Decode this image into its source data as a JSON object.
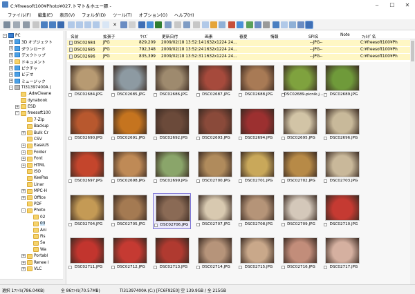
{
  "window": {
    "title": "C:¥freesoft100¥Photo¥027.トマト＆ホエー豚 -",
    "buttons": [
      "minimize",
      "maximize",
      "close"
    ]
  },
  "menu": [
    "ファイル(F)",
    "編集(E)",
    "表示(V)",
    "フォルダ(D)",
    "ツール(T)",
    "オプション(O)",
    "ヘルプ(H)"
  ],
  "tree": [
    {
      "label": "PC",
      "icon": "pc-icon",
      "depth": 0,
      "expander": "-"
    },
    {
      "label": "3D オブジェクト",
      "icon": "folder-blue-icon",
      "depth": 1,
      "expander": "+"
    },
    {
      "label": "ダウンロード",
      "icon": "download-icon",
      "depth": 1,
      "expander": "+"
    },
    {
      "label": "デスクトップ",
      "icon": "desktop-icon",
      "depth": 1,
      "expander": "+"
    },
    {
      "label": "ドキュメント",
      "icon": "documents-icon",
      "depth": 1,
      "expander": "+"
    },
    {
      "label": "ピクチャ",
      "icon": "pictures-icon",
      "depth": 1,
      "expander": "+"
    },
    {
      "label": "ビデオ",
      "icon": "videos-icon",
      "depth": 1,
      "expander": "+"
    },
    {
      "label": "ミュージック",
      "icon": "music-icon",
      "depth": 1,
      "expander": "+"
    },
    {
      "label": "TI31397400A (",
      "icon": "drive-icon",
      "depth": 1,
      "expander": "-"
    },
    {
      "label": ".AdwCleane",
      "icon": "folder-icon",
      "depth": 2,
      "expander": ""
    },
    {
      "label": "dynabook",
      "icon": "folder-icon",
      "depth": 2,
      "expander": ""
    },
    {
      "label": "ESD",
      "icon": "folder-icon",
      "depth": 2,
      "expander": "+"
    },
    {
      "label": "freesoft100",
      "icon": "folder-icon",
      "depth": 2,
      "expander": "-"
    },
    {
      "label": "7-Zip",
      "icon": "folder-icon",
      "depth": 3,
      "expander": ""
    },
    {
      "label": "Backup",
      "icon": "folder-icon",
      "depth": 3,
      "expander": ""
    },
    {
      "label": "Bulk Cr",
      "icon": "folder-icon",
      "depth": 3,
      "expander": "+"
    },
    {
      "label": "CSV",
      "icon": "folder-icon",
      "depth": 3,
      "expander": ""
    },
    {
      "label": "EaseUS",
      "icon": "folder-icon",
      "depth": 3,
      "expander": "+"
    },
    {
      "label": "Folder",
      "icon": "folder-icon",
      "depth": 3,
      "expander": "+"
    },
    {
      "label": "Font",
      "icon": "folder-icon",
      "depth": 3,
      "expander": "+"
    },
    {
      "label": "HTML",
      "icon": "folder-icon",
      "depth": 3,
      "expander": "+"
    },
    {
      "label": "ISO",
      "icon": "folder-icon",
      "depth": 3,
      "expander": ""
    },
    {
      "label": "KeePas",
      "icon": "folder-icon",
      "depth": 3,
      "expander": ""
    },
    {
      "label": "Linar",
      "icon": "folder-icon",
      "depth": 3,
      "expander": ""
    },
    {
      "label": "MPC-H",
      "icon": "folder-icon",
      "depth": 3,
      "expander": "+"
    },
    {
      "label": "Office",
      "icon": "folder-icon",
      "depth": 3,
      "expander": "+"
    },
    {
      "label": "PDF",
      "icon": "folder-icon",
      "depth": 3,
      "expander": ""
    },
    {
      "label": "Photo",
      "icon": "folder-icon",
      "depth": 3,
      "expander": "-"
    },
    {
      "label": "02",
      "icon": "folder-icon",
      "depth": 4,
      "expander": ""
    },
    {
      "label": "03",
      "icon": "folder-icon",
      "depth": 4,
      "expander": "",
      "selected": true
    },
    {
      "label": "Ani",
      "icon": "folder-icon",
      "depth": 4,
      "expander": ""
    },
    {
      "label": "Fis",
      "icon": "folder-icon",
      "depth": 4,
      "expander": ""
    },
    {
      "label": "Sa",
      "icon": "folder-icon",
      "depth": 4,
      "expander": ""
    },
    {
      "label": "Wa",
      "icon": "folder-icon",
      "depth": 4,
      "expander": ""
    },
    {
      "label": "Portabl",
      "icon": "folder-icon",
      "depth": 3,
      "expander": "+"
    },
    {
      "label": "Renee I",
      "icon": "folder-icon",
      "depth": 3,
      "expander": "+"
    },
    {
      "label": "VLC",
      "icon": "folder-icon",
      "depth": 3,
      "expander": "+"
    }
  ],
  "list": {
    "columns": [
      "名前",
      "拡張子",
      "ｻｲｽﾞ",
      "更新日付",
      "画素",
      "春夏",
      "情報",
      "SPI名",
      "Note",
      "ﾌｫﾙﾀﾞ名"
    ],
    "rows": [
      {
        "name": "DSC02684",
        "ext": "JPG",
        "size": "829,209",
        "date": "2009/02/18 13:52:14",
        "pixels": "1632x1224 24...",
        "spi": "--JPG--",
        "folder": "C:¥freesoft100¥Ph"
      },
      {
        "name": "DSC02685",
        "ext": "JPG",
        "size": "792,348",
        "date": "2009/02/18 13:52:24",
        "pixels": "1632x1224 24...",
        "spi": "--JPG--",
        "folder": "C:¥freesoft100¥Ph"
      },
      {
        "name": "DSC02686",
        "ext": "JPG",
        "size": "835,399",
        "date": "2009/02/18 13:52:31",
        "pixels": "1632x1224 24...",
        "spi": "--JPG--",
        "folder": "C:¥freesoft100¥Ph"
      }
    ]
  },
  "thumbnails": [
    {
      "label": "DSC02684.JPG",
      "color": "#b79a72"
    },
    {
      "label": "DSC02685.JPG",
      "color": "#8d9aa2"
    },
    {
      "label": "DSC02686.JPG",
      "color": "#9e8a6e"
    },
    {
      "label": "DSC02687.JPG",
      "color": "#a64a3c"
    },
    {
      "label": "DSC02688.JPG",
      "color": "#a87a55"
    },
    {
      "label": "DSC02689-picnik.j...",
      "color": "#7fa23e"
    },
    {
      "label": "DSC02689.JPG",
      "color": "#6f9a3a"
    },
    {
      "label": "DSC02690.JPG",
      "color": "#b8582e"
    },
    {
      "label": "DSC02691.JPG",
      "color": "#c5741f"
    },
    {
      "label": "DSC02692.JPG",
      "color": "#6b4a3a"
    },
    {
      "label": "DSC02693.JPG",
      "color": "#8a4a3a"
    },
    {
      "label": "DSC02694.JPG",
      "color": "#9c3030"
    },
    {
      "label": "DSC02695.JPG",
      "color": "#d2c4a6"
    },
    {
      "label": "DSC02696.JPG",
      "color": "#c8b99a"
    },
    {
      "label": "DSC02697.JPG",
      "color": "#c4452c"
    },
    {
      "label": "DSC02698.JPG",
      "color": "#bf8a56"
    },
    {
      "label": "DSC02699.JPG",
      "color": "#8aa56a"
    },
    {
      "label": "DSC02700.JPG",
      "color": "#b08b5c"
    },
    {
      "label": "DSC02701.JPG",
      "color": "#c9a85a"
    },
    {
      "label": "DSC02702.JPG",
      "color": "#b78a47"
    },
    {
      "label": "DSC02703.JPG",
      "color": "#c9b89a"
    },
    {
      "label": "DSC02704.JPG",
      "color": "#c49a55"
    },
    {
      "label": "DSC02705.JPG",
      "color": "#a47a52"
    },
    {
      "label": "DSC02706.JPG",
      "color": "#8a6a55",
      "selected": true
    },
    {
      "label": "DSC02707.JPG",
      "color": "#d8c9b0"
    },
    {
      "label": "DSC02708.JPG",
      "color": "#b59478"
    },
    {
      "label": "DSC02709.JPG",
      "color": "#d4c8ba"
    },
    {
      "label": "DSC02710.JPG",
      "color": "#c53a32"
    },
    {
      "label": "DSC02711.JPG",
      "color": "#c2352e"
    },
    {
      "label": "DSC02712.JPG",
      "color": "#c53a32"
    },
    {
      "label": "DSC02713.JPG",
      "color": "#b03a30"
    },
    {
      "label": "DSC02714.JPG",
      "color": "#b6947a"
    },
    {
      "label": "DSC02715.JPG",
      "color": "#c9a88a"
    },
    {
      "label": "DSC02716.JPG",
      "color": "#c28d7a"
    },
    {
      "label": "DSC02717.JPG",
      "color": "#d5b0a0"
    }
  ],
  "status": {
    "selection": "選択 1ﾌｧｲﾙ(786.04KB)",
    "total": "全 86ﾌｧｲﾙ(70.57MB)",
    "drive": "TI31397400A (C:) [FC6F92E0] 空 139.9GB / 全 215GB"
  }
}
